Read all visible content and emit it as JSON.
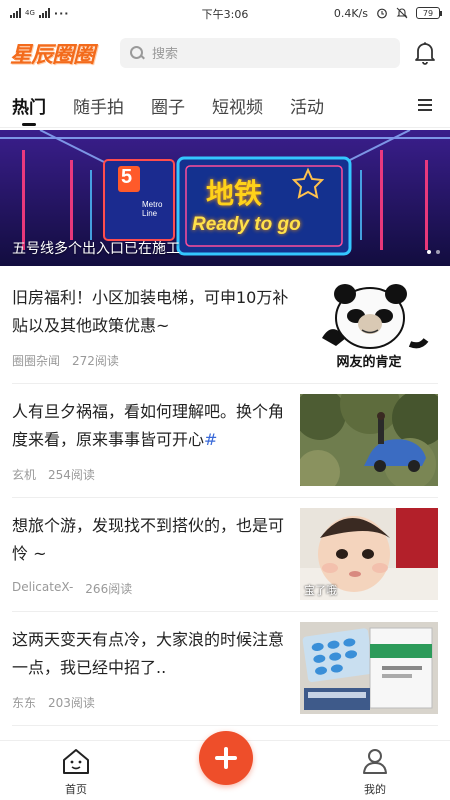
{
  "status_bar": {
    "network_small": "4G",
    "time": "下午3:06",
    "speed": "0.4K/s",
    "battery": "79"
  },
  "header": {
    "logo_text": "星辰圈圈",
    "search_placeholder": "搜索"
  },
  "tabs": [
    {
      "label": "热门",
      "active": true
    },
    {
      "label": "随手拍",
      "active": false
    },
    {
      "label": "圈子",
      "active": false
    },
    {
      "label": "短视频",
      "active": false
    },
    {
      "label": "活动",
      "active": false
    }
  ],
  "banner": {
    "caption": "五号线多个出入口已在施工",
    "sign_line1": "地铁",
    "sign_line2": "Ready to go",
    "badge_number": "5",
    "badge_text": "Metro Line"
  },
  "feed": [
    {
      "title": "旧房福利！小区加装电梯，可申10万补贴以及其他政策优惠~",
      "source": "圈圈杂闻",
      "reads": "272阅读",
      "thumb_caption": "网友的肯定",
      "thumb_type": "panda-meme"
    },
    {
      "title": "人有旦夕祸福，看如何理解吧。换个角度来看，原来事事皆可开心",
      "title_tag": "#",
      "source": "玄机",
      "reads": "254阅读",
      "thumb_type": "car-in-bushes"
    },
    {
      "title": "想旅个游，发现找不到搭伙的，也是可怜 ~",
      "source": "DelicateX-",
      "reads": "266阅读",
      "thumb_type": "baby-photo",
      "thumb_overlay": "宝了哦"
    },
    {
      "title": "这两天变天有点冷，大家浪的时候注意一点，我已经中招了..",
      "source": "东东",
      "reads": "203阅读",
      "thumb_type": "medicine-boxes"
    }
  ],
  "bottom_nav": {
    "home_label": "首页",
    "profile_label": "我的",
    "fab_icon": "plus-icon"
  },
  "colors": {
    "brand": "#f36b1c",
    "fab": "#ee4e2a",
    "banner_bg": "#2d1a7e"
  }
}
